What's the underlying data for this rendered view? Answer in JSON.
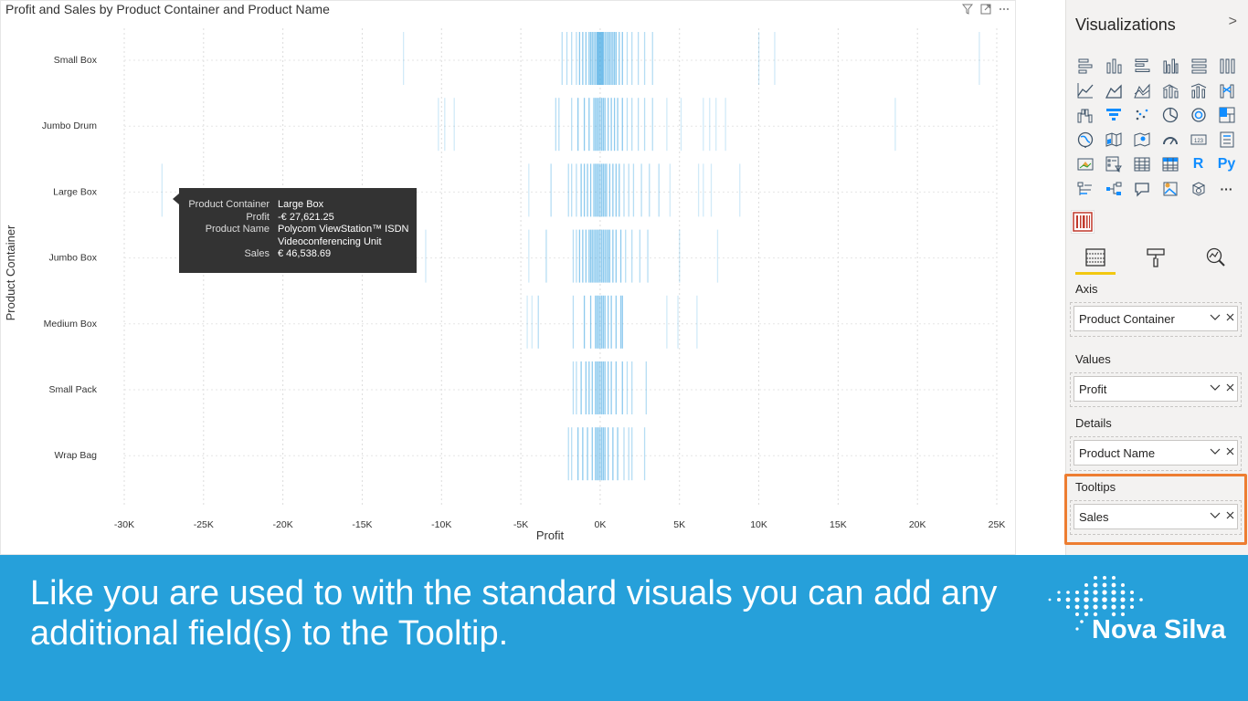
{
  "visual": {
    "title": "Profit and Sales by Product Container and Product Name",
    "icons": [
      "filter-icon",
      "focus-mode-icon",
      "more-options-icon"
    ]
  },
  "chart_data": {
    "type": "scatter",
    "title": "Profit and Sales by Product Container and Product Name",
    "xlabel": "Profit",
    "ylabel": "Product Container",
    "xlim": [
      -30000,
      25000
    ],
    "x_ticks": [
      "-30K",
      "-25K",
      "-20K",
      "-15K",
      "-10K",
      "-5K",
      "0K",
      "5K",
      "10K",
      "15K",
      "20K",
      "25K"
    ],
    "x_tick_values": [
      -30000,
      -25000,
      -20000,
      -15000,
      -10000,
      -5000,
      0,
      5000,
      10000,
      15000,
      20000,
      25000
    ],
    "categories": [
      "Small Box",
      "Jumbo Drum",
      "Large Box",
      "Jumbo Box",
      "Medium Box",
      "Small Pack",
      "Wrap Bag"
    ],
    "grid": true,
    "mark_color": "#2f9fe0",
    "series": [
      {
        "category": "Small Box",
        "values": [
          -12400,
          -2400,
          -2100,
          -1800,
          -1500,
          -1300,
          -1100,
          -900,
          -700,
          -600,
          -500,
          -400,
          -300,
          -200,
          -150,
          -100,
          -50,
          0,
          50,
          100,
          150,
          200,
          300,
          400,
          500,
          600,
          700,
          800,
          900,
          1000,
          1200,
          1400,
          1700,
          2000,
          2400,
          2800,
          3300,
          10000,
          11000,
          23900
        ]
      },
      {
        "category": "Jumbo Drum",
        "values": [
          -10200,
          -9800,
          -9200,
          -2800,
          -2600,
          -1800,
          -1400,
          -1000,
          -700,
          -400,
          -300,
          -200,
          -100,
          0,
          100,
          200,
          300,
          500,
          700,
          900,
          1100,
          1400,
          1700,
          2000,
          2400,
          2800,
          3300,
          4200,
          5100,
          6500,
          6900,
          7300,
          7900,
          18600
        ]
      },
      {
        "category": "Large Box",
        "values": [
          -27621.25,
          -4500,
          -3100,
          -2000,
          -1800,
          -1500,
          -1200,
          -1000,
          -800,
          -600,
          -400,
          -300,
          -200,
          -100,
          0,
          100,
          200,
          300,
          400,
          600,
          800,
          1000,
          1200,
          1500,
          1800,
          2100,
          2600,
          3100,
          3700,
          4400,
          6200,
          6500,
          7000,
          8800
        ]
      },
      {
        "category": "Jumbo Box",
        "values": [
          -11000,
          -4500,
          -3400,
          -1700,
          -1500,
          -1300,
          -1100,
          -900,
          -700,
          -600,
          -500,
          -400,
          -300,
          -200,
          -100,
          0,
          100,
          200,
          300,
          400,
          500,
          600,
          800,
          1000,
          1300,
          1600,
          2000,
          2500,
          3000,
          5000,
          7400
        ]
      },
      {
        "category": "Medium Box",
        "values": [
          -4600,
          -4300,
          -3900,
          -1700,
          -1000,
          -600,
          -300,
          -200,
          -100,
          0,
          100,
          200,
          300,
          500,
          700,
          1000,
          1300,
          1400,
          4200,
          4900,
          6100
        ]
      },
      {
        "category": "Small Pack",
        "values": [
          -1700,
          -1500,
          -1200,
          -900,
          -700,
          -500,
          -300,
          -200,
          -100,
          0,
          100,
          200,
          300,
          500,
          700,
          1000,
          1400,
          1700,
          2000,
          2900
        ]
      },
      {
        "category": "Wrap Bag",
        "values": [
          -2000,
          -1800,
          -1400,
          -1100,
          -800,
          -500,
          -300,
          -200,
          -100,
          0,
          100,
          200,
          300,
          500,
          800,
          1100,
          1500,
          1800,
          2000,
          2800
        ]
      }
    ]
  },
  "tooltip": {
    "rows": [
      {
        "key": "Product Container",
        "value": "Large Box"
      },
      {
        "key": "Profit",
        "value": "-€ 27,621.25"
      },
      {
        "key": "Product Name",
        "value": "Polycom ViewStation™ ISDN Videoconferencing Unit"
      },
      {
        "key": "Sales",
        "value": "€ 46,538.69"
      }
    ]
  },
  "pane": {
    "title": "Visualizations",
    "collapse_glyph": ">",
    "viz_icons": [
      "stacked-bar-chart-icon",
      "stacked-column-chart-icon",
      "clustered-bar-chart-icon",
      "clustered-column-chart-icon",
      "100-stacked-bar-chart-icon",
      "100-stacked-column-chart-icon",
      "line-chart-icon",
      "area-chart-icon",
      "stacked-area-chart-icon",
      "line-and-stacked-column-chart-icon",
      "line-and-clustered-column-chart-icon",
      "ribbon-chart-icon",
      "waterfall-chart-icon",
      "funnel-icon",
      "scatter-chart-icon",
      "pie-chart-icon",
      "donut-chart-icon",
      "treemap-icon",
      "map-icon",
      "filled-map-icon",
      "shape-map-icon",
      "gauge-icon",
      "card-icon",
      "multi-row-card-icon",
      "kpi-icon",
      "slicer-icon",
      "table-icon",
      "matrix-icon",
      "r-visual-icon",
      "python-visual-icon",
      "key-influencers-icon",
      "decomposition-tree-icon",
      "qa-icon",
      "arcgis-map-icon",
      "power-apps-icon",
      "more-visuals-icon"
    ],
    "r_label": "R",
    "py_label": "Py",
    "more_label": "···",
    "custom_visual_icon": "barcode-visual-icon",
    "tabs": [
      "fields-tab-icon",
      "format-tab-icon",
      "analytics-tab-icon"
    ],
    "wells": [
      {
        "label": "Axis",
        "field": "Product Container"
      },
      {
        "label": "Values",
        "field": "Profit"
      },
      {
        "label": "Details",
        "field": "Product Name"
      },
      {
        "label": "Tooltips",
        "field": "Sales"
      }
    ],
    "highlight_color": "#ed7d31"
  },
  "banner": {
    "text": "Like you are used to with the standard visuals you can add any additional field(s) to the Tooltip.",
    "brand_name": "Nova Silva",
    "color": "#26a0da"
  }
}
